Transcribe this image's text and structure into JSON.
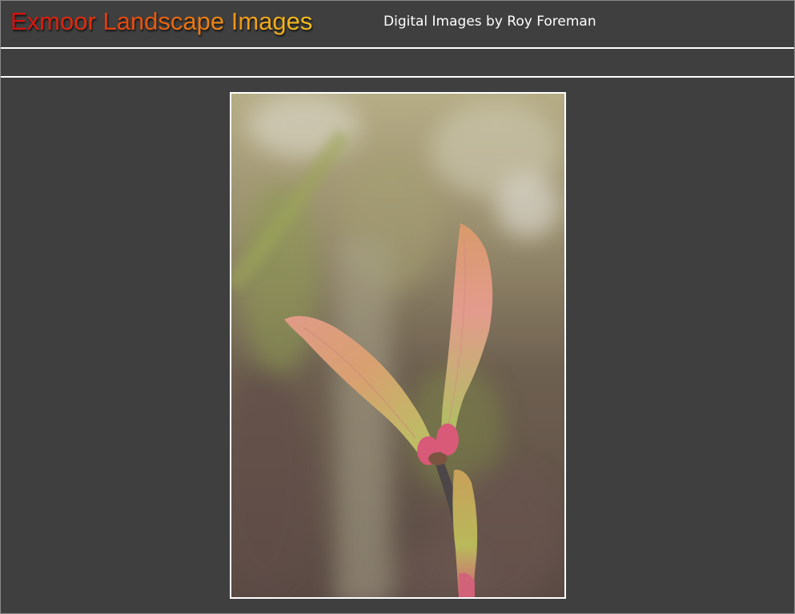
{
  "header": {
    "title": "Exmoor Landscape Images",
    "subtitle": "Digital Images by Roy Foreman"
  },
  "photo": {
    "subject": "opening leaf buds on a twig against a soft blurred background",
    "icon": "photo-image"
  },
  "colors": {
    "page_background": "#3f3f3f",
    "title_gradient_start": "#d21010",
    "title_gradient_end": "#f4c21c",
    "subtitle_text": "#ffffff",
    "rule_line": "#ffffff",
    "photo_border": "#ffffff"
  }
}
